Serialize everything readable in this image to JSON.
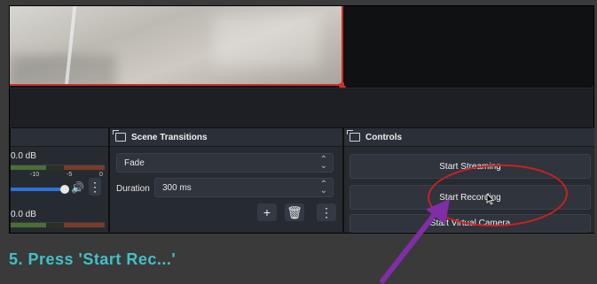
{
  "mixer": {
    "db_top": "0.0 dB",
    "ticks": [
      "-10",
      "-5",
      "0"
    ],
    "db_bottom": "0.0 dB",
    "menu_glyph": "⋮"
  },
  "transitions": {
    "title": "Scene Transitions",
    "selected": "Fade",
    "duration_label": "Duration",
    "duration_value": "300 ms",
    "add_glyph": "+",
    "delete_glyph": "🗑",
    "menu_glyph": "⋮"
  },
  "controls": {
    "title": "Controls",
    "buttons": [
      "Start Streaming",
      "Start Recording",
      "Start Virtual Camera"
    ]
  },
  "caption": {
    "text": "5. Press 'Start Rec...'"
  },
  "colors": {
    "accent_blue": "#2d72d6",
    "annotation_red": "#d01f1f",
    "arrow_purple": "#7f2ea6",
    "caption_teal": "#42c1c7"
  }
}
